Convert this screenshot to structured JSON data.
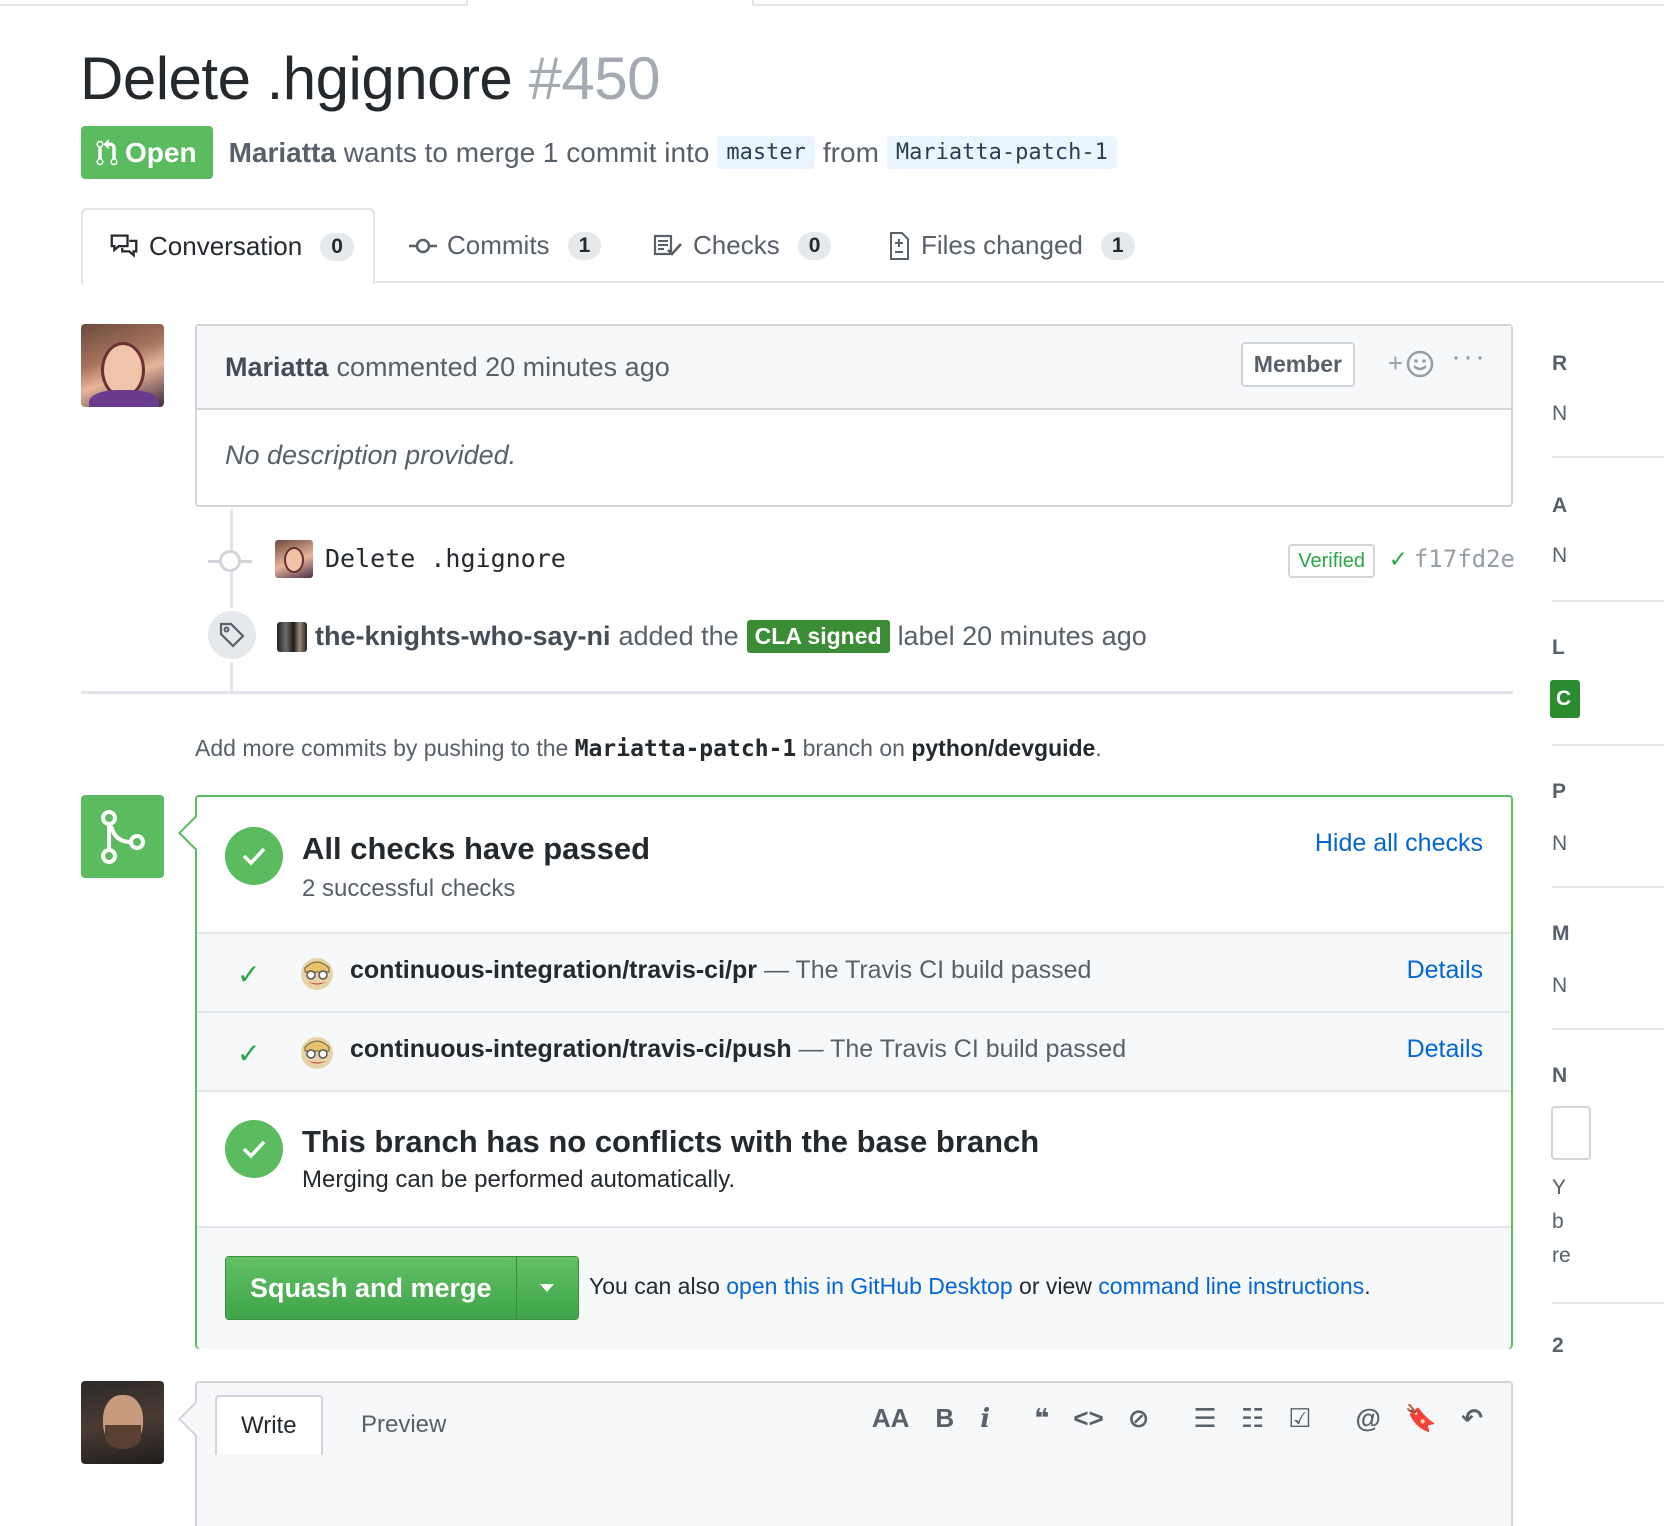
{
  "pr": {
    "title": "Delete .hgignore",
    "number": "#450",
    "state": "Open",
    "author": "Mariatta",
    "summary": "wants to merge 1 commit into",
    "base_branch": "master",
    "from_word": "from",
    "head_branch": "Mariatta-patch-1"
  },
  "tabs": [
    {
      "label": "Conversation",
      "count": "0"
    },
    {
      "label": "Commits",
      "count": "1"
    },
    {
      "label": "Checks",
      "count": "0"
    },
    {
      "label": "Files changed",
      "count": "1"
    }
  ],
  "comment": {
    "author": "Mariatta",
    "action": "commented 20 minutes ago",
    "badge": "Member",
    "reaction": "+",
    "more": "···",
    "body": "No description provided."
  },
  "commit": {
    "message": "Delete .hgignore",
    "verified": "Verified",
    "check": "✓",
    "sha": "f17fd2e"
  },
  "label_event": {
    "actor": "the-knights-who-say-ni",
    "before": "added the",
    "label": "CLA signed",
    "after": "label 20 minutes ago"
  },
  "push_hint": {
    "before": "Add more commits by pushing to the",
    "branch": "Mariatta-patch-1",
    "middle": "branch on",
    "repo": "python/devguide",
    "end": "."
  },
  "checks": {
    "title": "All checks have passed",
    "subtitle": "2 successful checks",
    "toggle": "Hide all checks",
    "items": [
      {
        "name": "continuous-integration/travis-ci/pr",
        "desc": "— The Travis CI build passed",
        "link": "Details"
      },
      {
        "name": "continuous-integration/travis-ci/push",
        "desc": "— The Travis CI build passed",
        "link": "Details"
      }
    ]
  },
  "conflicts": {
    "title": "This branch has no conflicts with the base branch",
    "subtitle": "Merging can be performed automatically."
  },
  "merge": {
    "button": "Squash and merge",
    "also": "You can also",
    "desktop_link": "open this in GitHub Desktop",
    "or_view": "or view",
    "cli_link": "command line instructions",
    "end": "."
  },
  "editor": {
    "write_tab": "Write",
    "preview_tab": "Preview",
    "tools": {
      "heading": "AA",
      "bold": "B",
      "italic": "i",
      "quote": "❝",
      "code": "<>",
      "link": "⊘",
      "ul": "☰",
      "ol": "☷",
      "task": "☑",
      "mention": "@",
      "ref": "🔖",
      "reply": "↶"
    }
  },
  "sidebar_fragments": {
    "h1": "R",
    "v1": "N",
    "h2": "A",
    "v2": "N",
    "h3": "L",
    "label": "C",
    "h4": "P",
    "v4": "N",
    "h5": "M",
    "v5": "N",
    "h6": "N",
    "t1": "Y",
    "t2": "b",
    "t3": "re",
    "h7": "2"
  },
  "colors": {
    "green": "#5bbc5f",
    "link_blue": "#0366d6",
    "label_green": "#3a8d34",
    "border": "#d1d5da"
  }
}
